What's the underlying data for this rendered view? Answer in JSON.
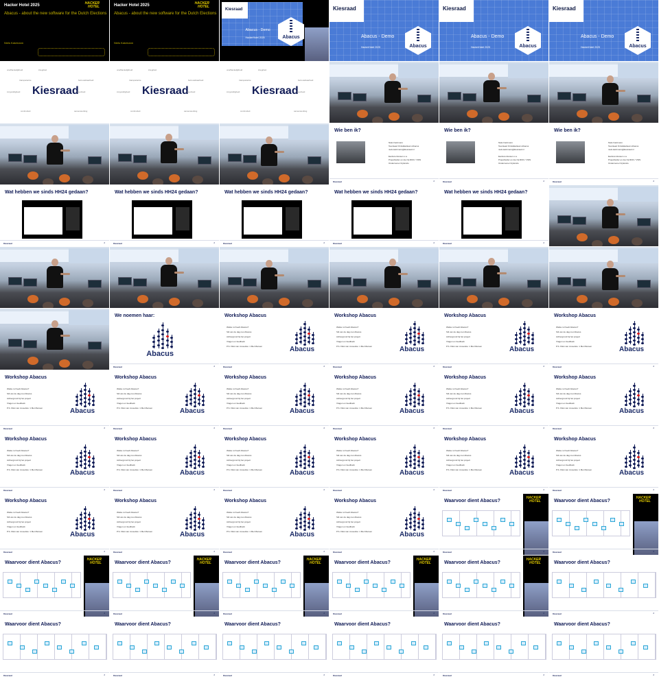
{
  "grid": {
    "cols": 6,
    "rows": 11
  },
  "colors": {
    "brand_navy": "#0f1a55",
    "accent_red": "#d11111",
    "demo_blue": "#4a7bd6",
    "hh_yellow": "#e8d000"
  },
  "title_slide": {
    "title": "Hacker Hotel 2025",
    "subtitle": "Abacus - about the new software for the Dutch Elections",
    "author": "Niels Katzmann",
    "logo_text": "HACKER HOTEL"
  },
  "demo_slide": {
    "org": "Kiesraad",
    "title": "Abacus - Demo",
    "subtitle": "HackerHotel 2025",
    "logo_text": "Abacus"
  },
  "kiesraad_slide": {
    "logo": "Kiesraad",
    "words": [
      "onafhankelijkheid",
      "integriteit",
      "transparantie",
      "betrouwbaarheid",
      "zorgvuldigheid",
      "openheid",
      "continuïteit",
      "samenwerking"
    ]
  },
  "wie_slide": {
    "title": "Wie ben ik?",
    "lines": [
      "Niels Katzmann",
      "Teamlead Ontwikkelteam Abacus",
      "niels.katzmann@kiesraad.nl",
      "",
      "Eerdere klussen o.a.",
      "Projectleider en dev bij RDO / VWS",
      "Ondernemer bij Ensilo"
    ]
  },
  "hh24_slide": {
    "title": "Wat hebben we sinds HH24 gedaan?"
  },
  "noemen_slide": {
    "title": "We noemen haar:",
    "logo_text": "Abacus"
  },
  "workshop_slide": {
    "title": "Workshop Abacus",
    "bullets": [
      "Welke rol heeft Abacus?",
      "Stil van de dag met Abacus",
      "Achtergrond bij het project",
      "Vragen en feedback",
      "P.S. Fikst van zoveelste: 1 Mei Mensen"
    ],
    "logo_text": "Abacus"
  },
  "waarvoor_slide": {
    "title": "Waarvoor dient Abacus?",
    "logo_text": "HACKER HOTEL"
  },
  "footer": {
    "left": "Kiesraad",
    "right": "2"
  }
}
